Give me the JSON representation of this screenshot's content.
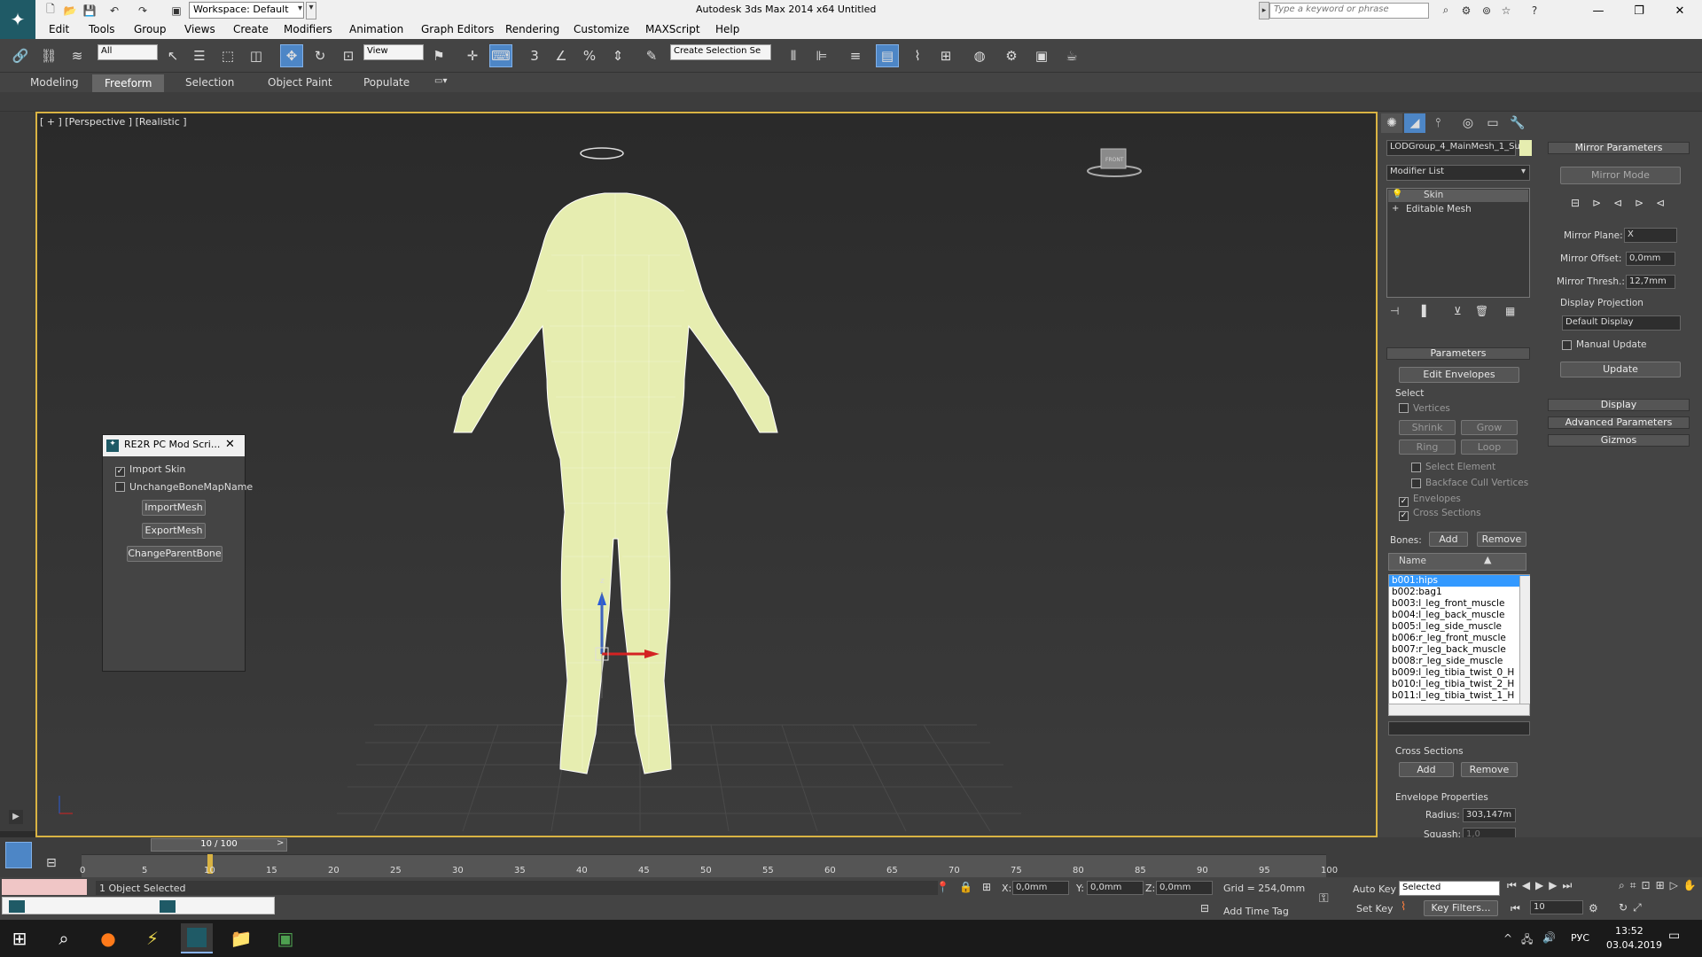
{
  "title_bar": {
    "workspace": "Workspace: Default",
    "app_title": "Autodesk 3ds Max  2014 x64    Untitled",
    "search_placeholder": "Type a keyword or phrase"
  },
  "menu": [
    "Edit",
    "Tools",
    "Group",
    "Views",
    "Create",
    "Modifiers",
    "Animation",
    "Graph Editors",
    "Rendering",
    "Customize",
    "MAXScript",
    "Help"
  ],
  "toolbar": {
    "selection_filter": "All",
    "ref_coord": "View",
    "named_selection": "Create Selection Se"
  },
  "ribbon_tabs": [
    "Modeling",
    "Freeform",
    "Selection",
    "Object Paint",
    "Populate"
  ],
  "ribbon_selected": "Freeform",
  "viewport": {
    "label": "[ + ] [Perspective ] [Realistic ]",
    "viewcube_label": "FRONT",
    "gizmo_axis": "z"
  },
  "skin_dialog": {
    "title": "RE2R PC Mod Scri...",
    "import_skin": "Import Skin",
    "unchange_bone": "UnchangeBoneMapName",
    "import_mesh": "ImportMesh",
    "export_mesh": "ExportMesh",
    "change_parent": "ChangeParentBone"
  },
  "command_panel": {
    "object_name": "LODGroup_4_MainMesh_1_Su",
    "modifier_list": "Modifier List",
    "stack": [
      "Skin",
      "Editable Mesh"
    ],
    "parameters": {
      "header": "Parameters",
      "edit_envelopes": "Edit Envelopes",
      "select_label": "Select",
      "vertices": "Vertices",
      "shrink": "Shrink",
      "grow": "Grow",
      "ring": "Ring",
      "loop": "Loop",
      "select_element": "Select Element",
      "backface": "Backface Cull Vertices",
      "envelopes": "Envelopes",
      "cross_sections": "Cross Sections",
      "bones_label": "Bones:",
      "add": "Add",
      "remove": "Remove",
      "name_col": "Name",
      "cross_sections_group": "Cross Sections",
      "cs_add": "Add",
      "cs_remove": "Remove",
      "envelope_props": "Envelope Properties",
      "radius_label": "Radius:",
      "radius_value": "303,147m",
      "squash_label": "Squash:",
      "squash_value": "1,0"
    },
    "bones": [
      "b001:hips",
      "b002:bag1",
      "b003:l_leg_front_muscle",
      "b004:l_leg_back_muscle",
      "b005:l_leg_side_muscle",
      "b006:r_leg_front_muscle",
      "b007:r_leg_back_muscle",
      "b008:r_leg_side_muscle",
      "b009:l_leg_tibia_twist_0_H",
      "b010:l_leg_tibia_twist_2_H",
      "b011:l_leg_tibia_twist_1_H"
    ],
    "mirror": {
      "header": "Mirror Parameters",
      "mode": "Mirror Mode",
      "plane_label": "Mirror Plane:",
      "plane_value": "X",
      "offset_label": "Mirror Offset:",
      "offset_value": "0,0mm",
      "thresh_label": "Mirror Thresh.:",
      "thresh_value": "12,7mm",
      "display_proj": "Display Projection",
      "display_value": "Default Display",
      "manual_update": "Manual Update",
      "update": "Update",
      "display": "Display",
      "advanced": "Advanced Parameters",
      "gizmos": "Gizmos"
    }
  },
  "timeline": {
    "slider": "10 / 100",
    "ticks": [
      "0",
      "5",
      "10",
      "15",
      "20",
      "25",
      "30",
      "35",
      "40",
      "45",
      "50",
      "55",
      "60",
      "65",
      "70",
      "75",
      "80",
      "85",
      "90",
      "95",
      "100"
    ],
    "current_frame": 10
  },
  "status": {
    "selected": "1 Object Selected",
    "x_label": "X:",
    "x_value": "0,0mm",
    "y_label": "Y:",
    "y_value": "0,0mm",
    "z_label": "Z:",
    "z_value": "0,0mm",
    "grid": "Grid = 254,0mm",
    "add_time_tag": "Add Time Tag",
    "auto_key": "Auto Key",
    "set_key": "Set Key",
    "key_mode": "Selected",
    "key_filters": "Key Filters...",
    "frame": "10"
  },
  "taskbar": {
    "lang": "РУС",
    "time": "13:52",
    "date": "03.04.2019"
  },
  "colors": {
    "accent": "#4d86c6",
    "viewport_border": "#d9b343",
    "mesh": "#e6edb0"
  }
}
